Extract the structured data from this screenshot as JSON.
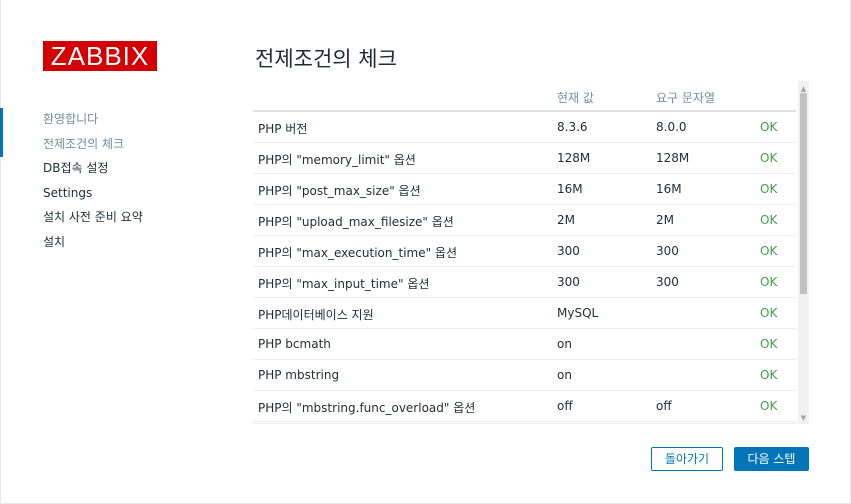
{
  "brand": {
    "logo_text": "ZABBIX",
    "logo_color": "#d40000"
  },
  "steps": [
    {
      "label": "환영합니다",
      "state": "done"
    },
    {
      "label": "전제조건의 체크",
      "state": "current"
    },
    {
      "label": "DB접속 설정",
      "state": "pending"
    },
    {
      "label": "Settings",
      "state": "pending"
    },
    {
      "label": "설치 사전 준비 요약",
      "state": "pending"
    },
    {
      "label": "설치",
      "state": "pending"
    }
  ],
  "page": {
    "title": "전제조건의 체크"
  },
  "table": {
    "headers": {
      "name": "",
      "current": "현재 값",
      "required": "요구 문자열",
      "result": ""
    },
    "rows": [
      {
        "name": "PHP 버전",
        "current": "8.3.6",
        "required": "8.0.0",
        "result": "OK"
      },
      {
        "name": "PHP의 \"memory_limit\" 옵션",
        "current": "128M",
        "required": "128M",
        "result": "OK"
      },
      {
        "name": "PHP의 \"post_max_size\" 옵션",
        "current": "16M",
        "required": "16M",
        "result": "OK"
      },
      {
        "name": "PHP의 \"upload_max_filesize\" 옵션",
        "current": "2M",
        "required": "2M",
        "result": "OK"
      },
      {
        "name": "PHP의 \"max_execution_time\" 옵션",
        "current": "300",
        "required": "300",
        "result": "OK"
      },
      {
        "name": "PHP의 \"max_input_time\" 옵션",
        "current": "300",
        "required": "300",
        "result": "OK"
      },
      {
        "name": "PHP데이터베이스 지원",
        "current": "MySQL",
        "required": "",
        "result": "OK"
      },
      {
        "name": "PHP bcmath",
        "current": "on",
        "required": "",
        "result": "OK"
      },
      {
        "name": "PHP mbstring",
        "current": "on",
        "required": "",
        "result": "OK"
      },
      {
        "name": "PHP의 \"mbstring.func_overload\" 옵션",
        "current": "off",
        "required": "off",
        "result": "OK"
      }
    ]
  },
  "buttons": {
    "back_label": "돌아가기",
    "next_label": "다음 스텝"
  },
  "colors": {
    "accent": "#0275b8",
    "ok": "#429e47"
  }
}
